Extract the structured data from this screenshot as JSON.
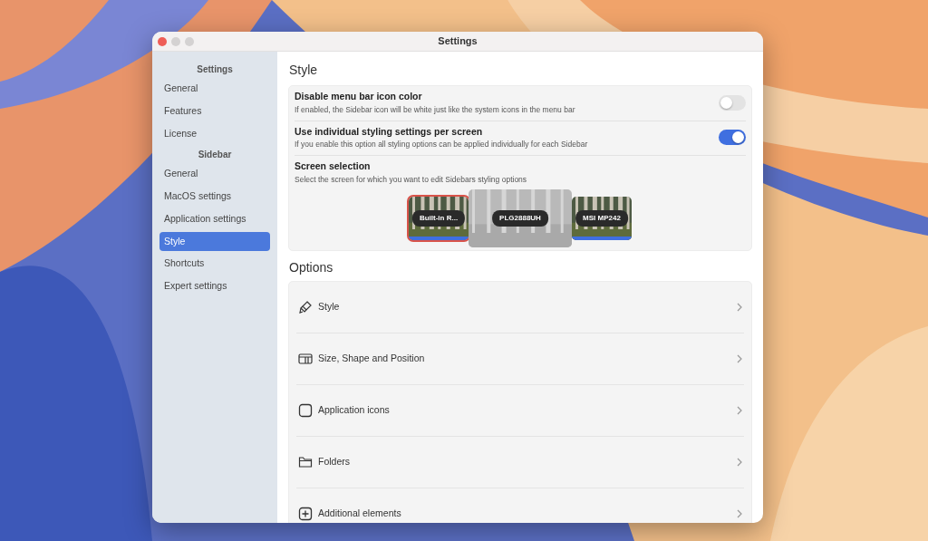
{
  "window": {
    "title": "Settings"
  },
  "sidebar": {
    "sections": [
      {
        "heading": "Settings",
        "items": [
          {
            "label": "General",
            "selected": false
          },
          {
            "label": "Features",
            "selected": false
          },
          {
            "label": "License",
            "selected": false
          }
        ]
      },
      {
        "heading": "Sidebar",
        "items": [
          {
            "label": "General",
            "selected": false
          },
          {
            "label": "MacOS settings",
            "selected": false
          },
          {
            "label": "Application settings",
            "selected": false
          },
          {
            "label": "Style",
            "selected": true
          },
          {
            "label": "Shortcuts",
            "selected": false
          },
          {
            "label": "Expert settings",
            "selected": false
          }
        ]
      }
    ]
  },
  "style": {
    "heading": "Style",
    "toggles": [
      {
        "title": "Disable menu bar icon color",
        "description": "If enabled, the Sidebar icon will be white just like the system icons in the menu bar",
        "on": false
      },
      {
        "title": "Use individual styling settings per screen",
        "description": "If you enable this option all styling options can be applied individually for each Sidebar",
        "on": true
      }
    ],
    "screen_selection": {
      "title": "Screen selection",
      "description": "Select the screen for which you want to edit Sidebars styling options",
      "screens": [
        {
          "name": "Built-in R...",
          "selected": true,
          "hovered": false
        },
        {
          "name": "PLG2888UH",
          "selected": false,
          "hovered": true
        },
        {
          "name": "MSI MP242",
          "selected": false,
          "hovered": false
        }
      ]
    }
  },
  "options": {
    "heading": "Options",
    "items": [
      {
        "label": "Style"
      },
      {
        "label": "Size, Shape and Position"
      },
      {
        "label": "Application icons"
      },
      {
        "label": "Folders"
      },
      {
        "label": "Additional elements"
      }
    ]
  }
}
